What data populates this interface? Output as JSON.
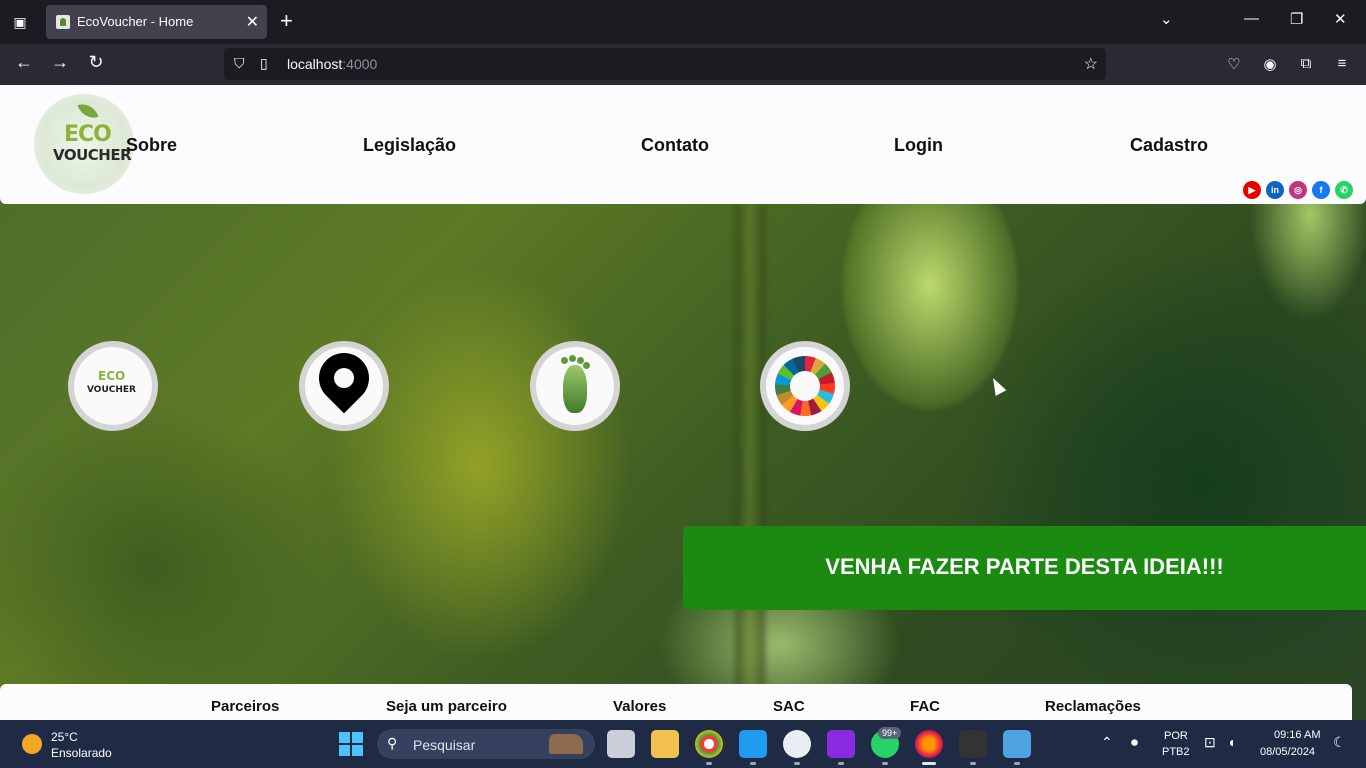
{
  "browser": {
    "tab_title": "EcoVoucher - Home",
    "url_host": "localhost",
    "url_port": ":4000"
  },
  "site": {
    "logo": {
      "line1": "ECO",
      "line2": "VOUCHER"
    },
    "nav": [
      "Sobre",
      "Legislação",
      "Contato",
      "Login",
      "Cadastro"
    ],
    "social": [
      {
        "name": "youtube",
        "glyph": "▶",
        "color": "#e60000"
      },
      {
        "name": "linkedin",
        "glyph": "in",
        "color": "#0a66c2"
      },
      {
        "name": "instagram",
        "glyph": "◎",
        "color": "#c13584"
      },
      {
        "name": "facebook",
        "glyph": "f",
        "color": "#1877f2"
      },
      {
        "name": "whatsapp",
        "glyph": "✆",
        "color": "#25d366"
      }
    ],
    "features": [
      "ecovoucher-logo-icon",
      "location-pin-icon",
      "green-footprint-icon",
      "sdg-wheel-icon"
    ],
    "feature_logo": {
      "line1": "ECO",
      "line2": "VOUCHER"
    },
    "cta": "VENHA FAZER PARTE DESTA IDEIA!!!",
    "footer": [
      "Parceiros",
      "Seja um parceiro",
      "Valores",
      "SAC",
      "FAC",
      "Reclamações"
    ]
  },
  "taskbar": {
    "weather_temp": "25°C",
    "weather_desc": "Ensolarado",
    "search_placeholder": "Pesquisar",
    "whatsapp_badge": "99+",
    "lang_line1": "POR",
    "lang_line2": "PTB2",
    "time": "09:16 AM",
    "date": "08/05/2024"
  }
}
